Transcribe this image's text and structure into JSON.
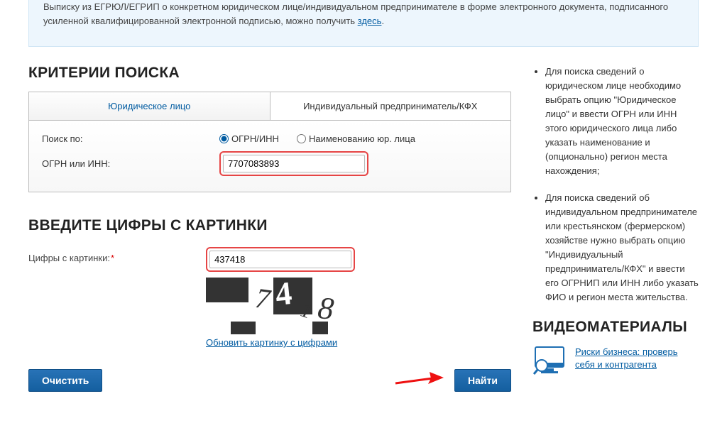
{
  "notice": {
    "text_before": "Выписку из ЕГРЮЛ/ЕГРИП о конкретном юридическом лице/индивидуальном предпринимателе в форме электронного документа, подписанного усиленной квалифицированной электронной подписью, можно получить ",
    "link_text": "здесь",
    "text_after": "."
  },
  "headings": {
    "criteria": "КРИТЕРИИ ПОИСКА",
    "captcha": "ВВЕДИТЕ ЦИФРЫ С КАРТИНКИ",
    "video": "ВИДЕОМАТЕРИАЛЫ"
  },
  "tabs": {
    "legal_entity": "Юридическое лицо",
    "individual": "Индивидуальный предприниматель/КФХ"
  },
  "criteria": {
    "search_by_label": "Поиск по:",
    "radio_ogrn": "ОГРН/ИНН",
    "radio_name": "Наименованию юр. лица",
    "ogrn_label": "ОГРН или ИНН:",
    "ogrn_value": "7707083893",
    "selected_radio": "ogrn"
  },
  "captcha": {
    "label": "Цифры с картинки:",
    "value": "437418",
    "refresh_label": "Обновить картинку с цифрами"
  },
  "buttons": {
    "clear": "Очистить",
    "find": "Найти"
  },
  "help_list": [
    "Для поиска сведений о юридическом лице необходимо выбрать опцию \"Юридическое лицо\" и ввести ОГРН или ИНН этого юридического лица либо указать наименование и (опционально) регион места нахождения;",
    "Для поиска сведений об индивидуальном предпринимателе или крестьянском (фермерском) хозяйстве нужно выбрать опцию \"Индивидуальный предприниматель/КФХ\" и ввести его ОГРНИП или ИНН либо указать ФИО и регион места жительства."
  ],
  "video": {
    "link_text": "Риски бизнеса: проверь себя и контрагента"
  }
}
